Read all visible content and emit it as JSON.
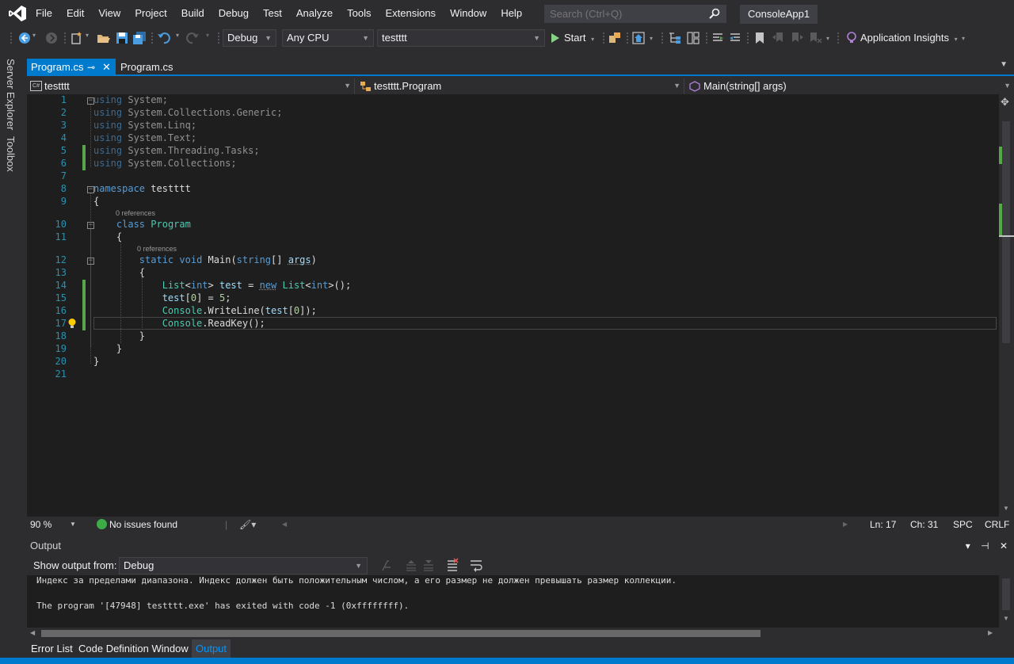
{
  "menu": {
    "items": [
      "File",
      "Edit",
      "View",
      "Project",
      "Build",
      "Debug",
      "Test",
      "Analyze",
      "Tools",
      "Extensions",
      "Window",
      "Help"
    ],
    "search_placeholder": "Search (Ctrl+Q)",
    "solution_name": "ConsoleApp1"
  },
  "toolbar": {
    "configuration": "Debug",
    "platform": "Any CPU",
    "startup_project": "testttt",
    "start_label": "Start",
    "app_insights_label": "Application Insights"
  },
  "side_tabs": [
    "Server Explorer",
    "Toolbox"
  ],
  "doc_tabs": [
    {
      "label": "Program.cs",
      "active": true
    },
    {
      "label": "Program.cs",
      "active": false
    }
  ],
  "navbar": {
    "project": "testttt",
    "class": "testttt.Program",
    "member": "Main(string[] args)",
    "project_badge": "C#"
  },
  "code": {
    "line_numbers": [
      "1",
      "2",
      "3",
      "4",
      "5",
      "6",
      "7",
      "8",
      "9",
      "10",
      "11",
      "12",
      "13",
      "14",
      "15",
      "16",
      "17",
      "18",
      "19",
      "20",
      "21"
    ],
    "references_label": "0 references",
    "usings": [
      "System",
      "System.Collections.Generic",
      "System.Linq",
      "System.Text",
      "System.Threading.Tasks",
      "System.Collections"
    ],
    "namespace": "testttt",
    "class_name": "Program",
    "method_signature": "Main",
    "param_type": "string",
    "param_name": "args",
    "element_type": "int",
    "var_name": "test",
    "list_type": "List",
    "index": "0",
    "assigned_value": "5",
    "console": "Console",
    "write_line": "WriteLine",
    "read_key": "ReadKey"
  },
  "editor_status": {
    "zoom": "90 %",
    "issues": "No issues found",
    "line": "Ln: 17",
    "col": "Ch: 31",
    "whitespace": "SPC",
    "line_ending": "CRLF"
  },
  "output": {
    "title": "Output",
    "show_from_label": "Show output from:",
    "source": "Debug",
    "lines": [
      "Индекс за пределами диапазона. Индекс должен быть положительным числом, а его размер не должен превышать размер коллекции.",
      "",
      "The program '[47948] testttt.exe' has exited with code -1 (0xffffffff)."
    ]
  },
  "bottom_tabs": [
    "Error List",
    "Code Definition Window",
    "Output"
  ],
  "colors": {
    "accent": "#007acc",
    "background": "#2d2d30",
    "editor_bg": "#1e1e1e",
    "keyword": "#569cd6",
    "type": "#4ec9b0",
    "change_bar": "#57a64a"
  }
}
